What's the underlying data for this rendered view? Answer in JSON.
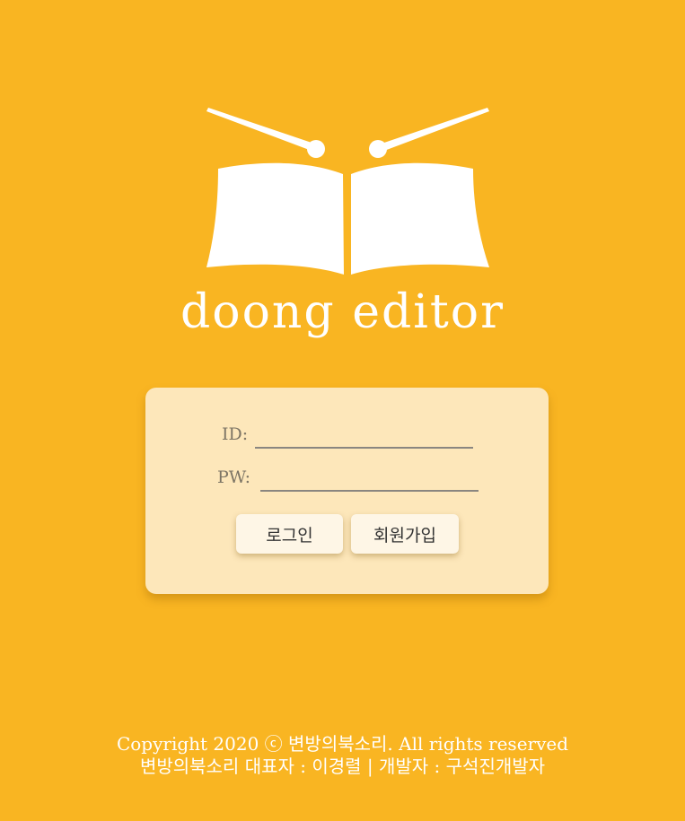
{
  "brand": {
    "name": "doong editor"
  },
  "login": {
    "id_label": "ID:",
    "id_value": "",
    "pw_label": "PW:",
    "pw_value": "",
    "login_button": "로그인",
    "signup_button": "회원가입"
  },
  "footer": {
    "copyright": "Copyright 2020 ⓒ 변방의북소리. All rights reserved",
    "credits": "변방의북소리 대표자 : 이경렬 | 개발자 : 구석진개발자"
  },
  "colors": {
    "background": "#F9B522",
    "card": "#FDE7BA",
    "button": "#FEF6E6"
  }
}
